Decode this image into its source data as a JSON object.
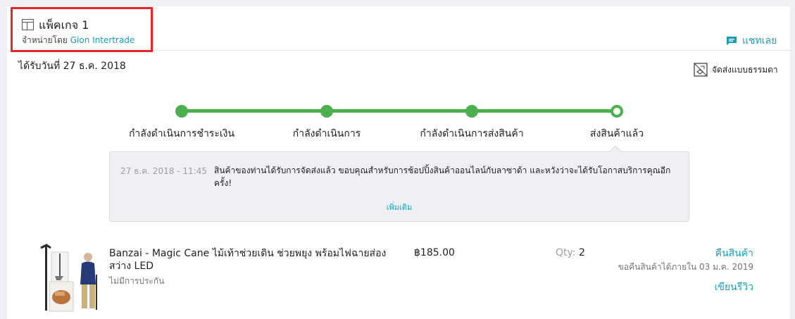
{
  "package": {
    "title": "แพ็คเกจ 1",
    "seller_prefix": "จำหน่ายโดย",
    "seller_name": "Gion Intertrade",
    "chat_label": "แชทเลย"
  },
  "received_text": "ได้รับวันที่ 27 ธ.ค. 2018",
  "shipping_method": "จัดส่งแบบธรรมดา",
  "progress": {
    "steps": [
      {
        "label": "กำลังดำเนินการชำระเงิน",
        "done": true
      },
      {
        "label": "กำลังดำเนินการ",
        "done": true
      },
      {
        "label": "กำลังดำเนินการส่งสินค้า",
        "done": true
      },
      {
        "label": "ส่งสินค้าแล้ว",
        "done": true,
        "current": true
      }
    ]
  },
  "message": {
    "time": "27 ธ.ค. 2018 - 11:45",
    "text": "สินค้าของท่านได้รับการจัดส่งแล้ว ขอบคุณสำหรับการช้อปปิ้งสินค้าออนไลน์กับลาซาด้า และหวังว่าจะได้รับโอกาสบริการคุณอีกครั้ง!",
    "more_label": "เพิ่มเติม"
  },
  "product": {
    "name": "Banzai - Magic Cane ไม้เท้าช่วยเดิน ช่วยพยุง พร้อมไฟฉายส่องสว่าง LED",
    "warranty": "ไม่มีการประกัน",
    "price": "฿185.00",
    "qty_label": "Qty:",
    "qty_value": "2",
    "return_label": "คืนสินค้า",
    "return_note": "ขอคืนสินค้าได้ภายใน 03 ม.ค. 2019",
    "review_label": "เขียนรีวิว"
  },
  "colors": {
    "accent": "#1a9cb7",
    "progress": "#4caf50",
    "highlight_box": "#e3252c"
  }
}
